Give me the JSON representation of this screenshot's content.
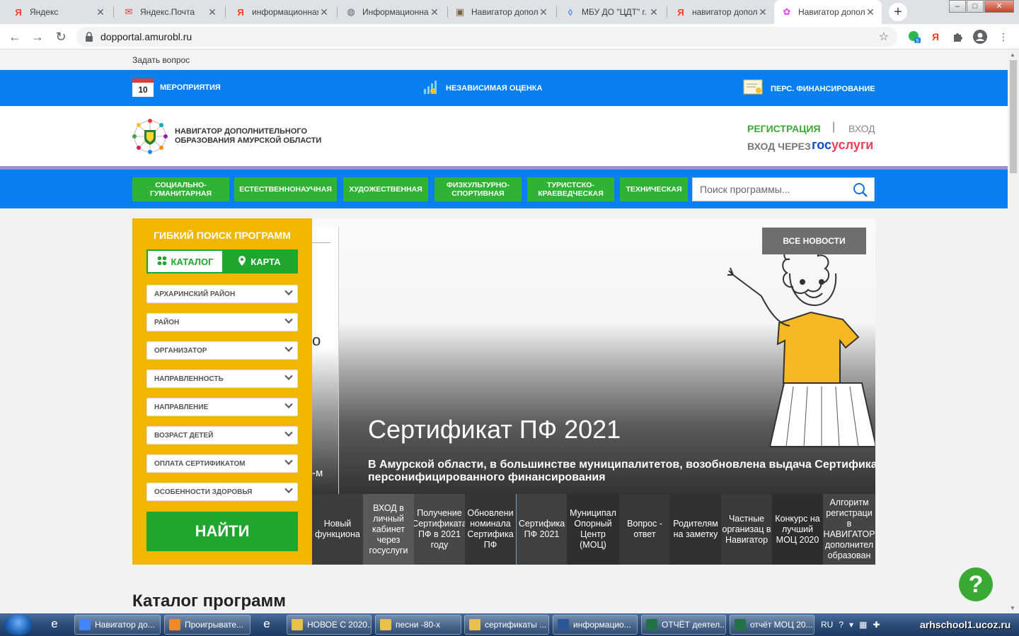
{
  "browser": {
    "tabs": [
      {
        "title": "Яндекс",
        "icon": "yandex-icon",
        "fav": "Я",
        "color": "#fc3f1d"
      },
      {
        "title": "Яндекс.Почта",
        "icon": "mail-icon",
        "fav": "✉",
        "color": "#e53935"
      },
      {
        "title": "информационная",
        "icon": "yandex-icon",
        "fav": "Я",
        "color": "#fc3f1d"
      },
      {
        "title": "Информационная",
        "icon": "globe-icon",
        "fav": "◍",
        "color": "#5f6368"
      },
      {
        "title": "Навигатор допол",
        "icon": "image-icon",
        "fav": "▣",
        "color": "#7b5e3b"
      },
      {
        "title": "МБУ ДО \"ЦДТ\" г.",
        "icon": "pin-icon",
        "fav": "◊",
        "color": "#4285f4"
      },
      {
        "title": "навигатор допол",
        "icon": "yandex-icon",
        "fav": "Я",
        "color": "#fc3f1d"
      },
      {
        "title": "Навигатор допол",
        "icon": "flower-icon",
        "fav": "✿",
        "color": "#e040fb",
        "active": true
      }
    ],
    "url": "dopportal.amurobl.ru",
    "extension_badge": "5",
    "yandex_ext": "Я",
    "win_controls": {
      "min": "–",
      "max": "□",
      "close": "✕"
    }
  },
  "site": {
    "ask_link": "Задать вопрос",
    "topnav": {
      "events_day": "10",
      "events": "МЕРОПРИЯТИЯ",
      "assessment": "НЕЗАВИСИМАЯ ОЦЕНКА",
      "financing": "ПЕРС. ФИНАНСИРОВАНИЕ"
    },
    "logo_line1": "НАВИГАТОР ДОПОЛНИТЕЛЬНОГО",
    "logo_line2": "ОБРАЗОВАНИЯ АМУРСКОЙ ОБЛАСТИ",
    "register": "РЕГИСТРАЦИЯ",
    "separator": "|",
    "login": "ВХОД",
    "gos_prefix": "ВХОД ЧЕРЕЗ",
    "gos_part1": "гос",
    "gos_part2": "услуги",
    "categories": [
      {
        "line1": "СОЦИАЛЬНО-",
        "line2": "ГУМАНИТАРНАЯ"
      },
      {
        "line1": "ЕСТЕСТВЕННОНАУЧНАЯ",
        "line2": ""
      },
      {
        "line1": "ХУДОЖЕСТВЕННАЯ",
        "line2": ""
      },
      {
        "line1": "ФИЗКУЛЬТУРНО-",
        "line2": "СПОРТИВНАЯ"
      },
      {
        "line1": "ТУРИСТСКО-",
        "line2": "КРАЕВЕДЧЕСКАЯ"
      },
      {
        "line1": "ТЕХНИЧЕСКАЯ",
        "line2": ""
      }
    ],
    "search_placeholder": "Поиск программы...",
    "filter": {
      "title": "ГИБКИЙ ПОИСК ПРОГРАММ",
      "catalog": "КАТАЛОГ",
      "map": "КАРТА",
      "selects": [
        "АРХАРИНСКИЙ РАЙОН",
        "РАЙОН",
        "ОРГАНИЗАТОР",
        "НАПРАВЛЕННОСТЬ",
        "НАПРАВЛЕНИЕ",
        "ВОЗРАСТ ДЕТЕЙ",
        "ОПЛАТА СЕРТИФИКАТОМ",
        "ОСОБЕННОСТИ ЗДОРОВЬЯ"
      ],
      "find": "НАЙТИ"
    },
    "hero": {
      "all_news": "ВСЕ НОВОСТИ",
      "left_frag1": "о",
      "left_frag2": "-м",
      "title": "Сертификат ПФ 2021",
      "subtitle1": "В Амурской области, в большинстве муниципалитетов, возобновлена выдача Сертификато",
      "subtitle2": "персонифицированного финансирования"
    },
    "news_thumbs": [
      {
        "text": "Новый функциона"
      },
      {
        "text": "ВХОД в личный кабинет через госуслуги"
      },
      {
        "text": "Получение Сертификата ПФ в 2021 году"
      },
      {
        "text": "Обновлени номинала Сертифика ПФ"
      },
      {
        "text": "Сертифика ПФ 2021"
      },
      {
        "text": "Муниципал Опорный Центр (МОЦ)"
      },
      {
        "text": "Вопрос - ответ"
      },
      {
        "text": "Родителям на заметку"
      },
      {
        "text": "Частные организац в Навигатор"
      },
      {
        "text": "Конкурс на лучший МОЦ 2020"
      },
      {
        "text": "Алгоритм регистраци в НАВИГАТОР дополнител образован"
      }
    ],
    "help": "?",
    "catalog_heading": "Каталог программ"
  },
  "taskbar": {
    "buttons": [
      {
        "label": "Навигатор до...",
        "color": "#4285f4"
      },
      {
        "label": "Проигрывате...",
        "color": "#f08a24"
      },
      {
        "label": "НОВОЕ С 2020...",
        "color": "#e8c14a"
      },
      {
        "label": "песни -80-х",
        "color": "#e8c14a"
      },
      {
        "label": "сертификаты ...",
        "color": "#e8c14a"
      },
      {
        "label": "информацио...",
        "color": "#2b579a"
      },
      {
        "label": "ОТЧЁТ деятел...",
        "color": "#217346"
      },
      {
        "label": "отчёт МОЦ 20...",
        "color": "#217346"
      }
    ],
    "lang": "RU",
    "tray_url": "arhschool1.ucoz.ru"
  }
}
